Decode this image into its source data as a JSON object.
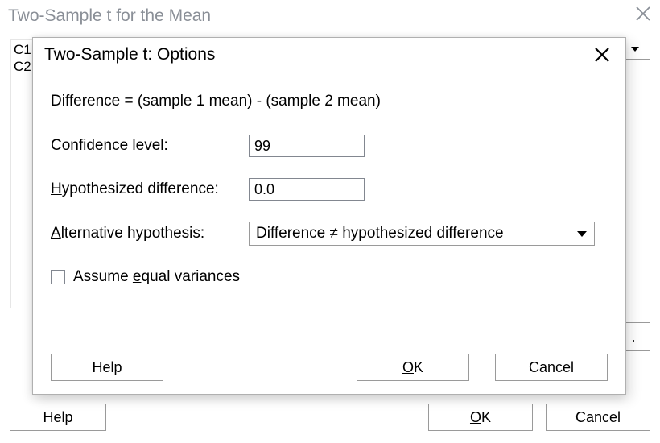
{
  "background_window": {
    "title": "Two-Sample t for the Mean",
    "listbox_items": [
      "C1",
      "C2"
    ],
    "right_button_label": ".",
    "buttons": {
      "help": "Help",
      "ok": "OK",
      "cancel": "Cancel"
    },
    "ok_mnemonic": "O"
  },
  "dialog": {
    "title": "Two-Sample t: Options",
    "formula": "Difference = (sample 1 mean) - (sample 2 mean)",
    "confidence": {
      "label_pre": "C",
      "label_post": "onfidence level:",
      "value": "99"
    },
    "hyp_diff": {
      "label_pre": "H",
      "label_post": "ypothesized difference:",
      "value": "0.0"
    },
    "alt_hyp": {
      "label_pre": "A",
      "label_post": "lternative hypothesis:",
      "selected": "Difference ≠ hypothesized difference"
    },
    "equal_var": {
      "label_pre": "Assume ",
      "label_u": "e",
      "label_post": "qual variances",
      "checked": false
    },
    "buttons": {
      "help": "Help",
      "ok": "OK",
      "cancel": "Cancel"
    },
    "ok_mnemonic": "O"
  }
}
